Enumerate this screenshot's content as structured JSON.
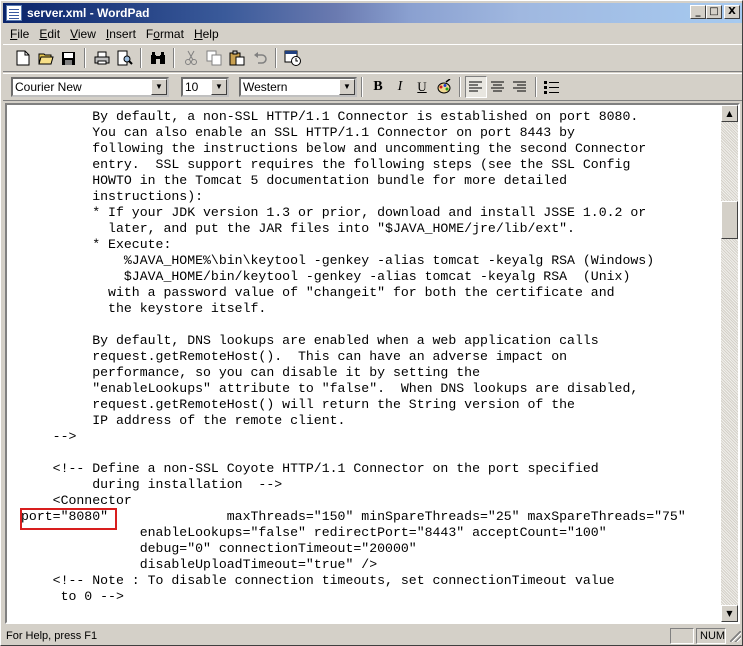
{
  "window": {
    "title": "server.xml - WordPad",
    "minimize": "_",
    "maximize": "□",
    "close": "X"
  },
  "menu": [
    "File",
    "Edit",
    "View",
    "Insert",
    "Format",
    "Help"
  ],
  "format_toolbar": {
    "font": "Courier New",
    "size": "10",
    "script": "Western",
    "bold": "B",
    "italic": "I",
    "underline": "U"
  },
  "document": {
    "lines": [
      "         By default, a non-SSL HTTP/1.1 Connector is established on port 8080.",
      "         You can also enable an SSL HTTP/1.1 Connector on port 8443 by",
      "         following the instructions below and uncommenting the second Connector",
      "         entry.  SSL support requires the following steps (see the SSL Config",
      "         HOWTO in the Tomcat 5 documentation bundle for more detailed",
      "         instructions):",
      "         * If your JDK version 1.3 or prior, download and install JSSE 1.0.2 or",
      "           later, and put the JAR files into \"$JAVA_HOME/jre/lib/ext\".",
      "         * Execute:",
      "             %JAVA_HOME%\\bin\\keytool -genkey -alias tomcat -keyalg RSA (Windows)",
      "             $JAVA_HOME/bin/keytool -genkey -alias tomcat -keyalg RSA  (Unix)",
      "           with a password value of \"changeit\" for both the certificate and",
      "           the keystore itself.",
      "",
      "         By default, DNS lookups are enabled when a web application calls",
      "         request.getRemoteHost().  This can have an adverse impact on",
      "         performance, so you can disable it by setting the",
      "         \"enableLookups\" attribute to \"false\".  When DNS lookups are disabled,",
      "         request.getRemoteHost() will return the String version of the",
      "         IP address of the remote client.",
      "    -->",
      "",
      "    <!-- Define a non-SSL Coyote HTTP/1.1 Connector on the port specified",
      "         during installation  -->",
      "    <Connector",
      "port=\"8080\"               maxThreads=\"150\" minSpareThreads=\"25\" maxSpareThreads=\"75\"",
      "               enableLookups=\"false\" redirectPort=\"8443\" acceptCount=\"100\"",
      "               debug=\"0\" connectionTimeout=\"20000\"",
      "               disableUploadTimeout=\"true\" />",
      "    <!-- Note : To disable connection timeouts, set connectionTimeout value",
      "     to 0 -->"
    ]
  },
  "status": {
    "help": "For Help, press F1",
    "num": "NUM"
  }
}
